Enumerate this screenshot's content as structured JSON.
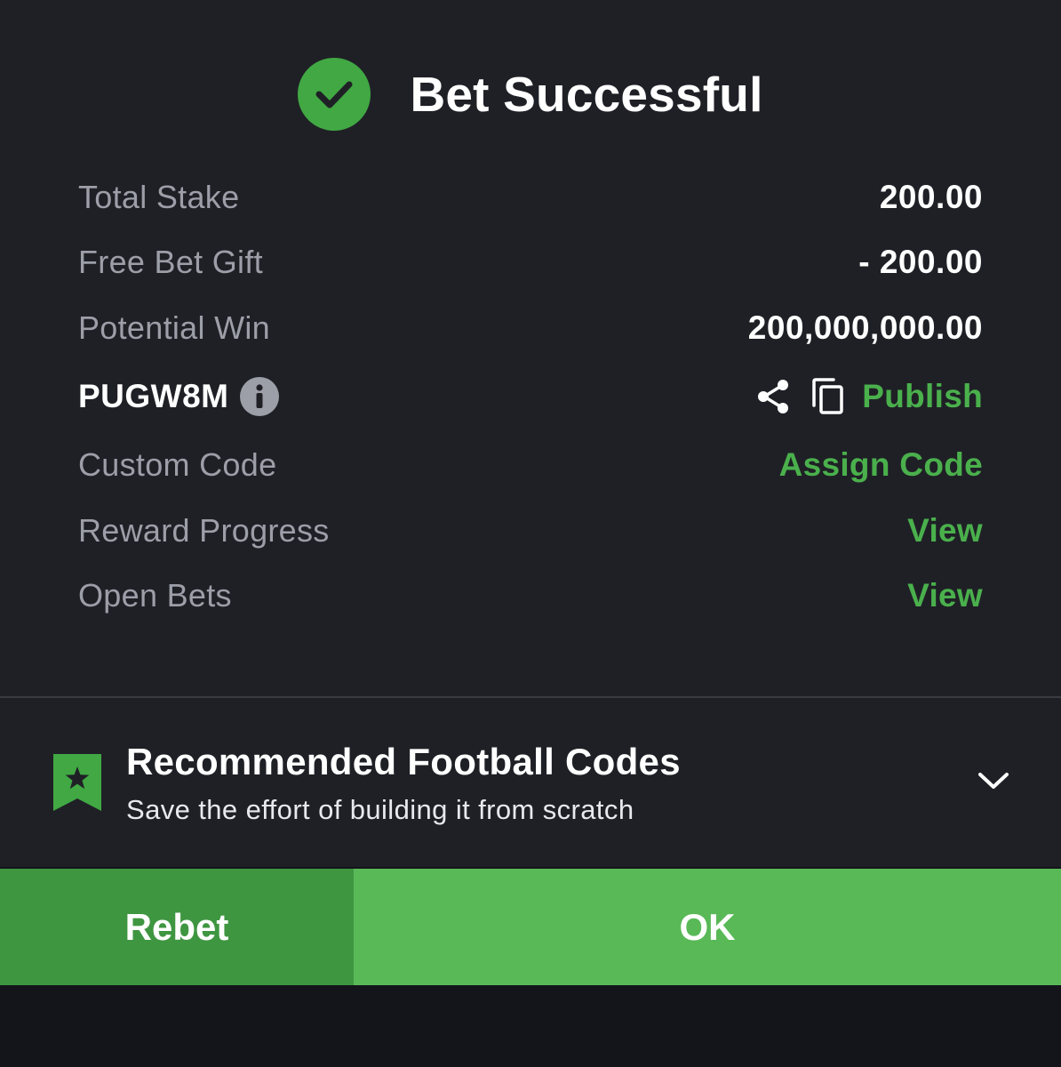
{
  "header": {
    "title": "Bet Successful",
    "icon": "check-circle-icon",
    "icon_color": "#41a843"
  },
  "summary": {
    "total_stake": {
      "label": "Total Stake",
      "value": "200.00"
    },
    "free_bet_gift": {
      "label": "Free Bet Gift",
      "value": "- 200.00"
    },
    "potential_win": {
      "label": "Potential Win",
      "value": "200,000,000.00"
    }
  },
  "booking": {
    "code": "PUGW8M",
    "info_icon": "info-icon",
    "share_icon": "share-icon",
    "copy_icon": "copy-icon",
    "publish_label": "Publish"
  },
  "links": {
    "custom_code": {
      "label": "Custom Code",
      "action": "Assign Code"
    },
    "reward_progress": {
      "label": "Reward Progress",
      "action": "View"
    },
    "open_bets": {
      "label": "Open Bets",
      "action": "View"
    }
  },
  "recommended": {
    "icon": "bookmark-star-icon",
    "title": "Recommended Football Codes",
    "subtitle": "Save the effort of building it from scratch",
    "toggle_icon": "chevron-down-icon"
  },
  "actions": {
    "rebet_label": "Rebet",
    "ok_label": "OK"
  },
  "colors": {
    "accent_green": "#4ab04c",
    "rebet_bg": "#3f9641",
    "ok_bg": "#59b957",
    "panel_bg": "#1f2026"
  }
}
